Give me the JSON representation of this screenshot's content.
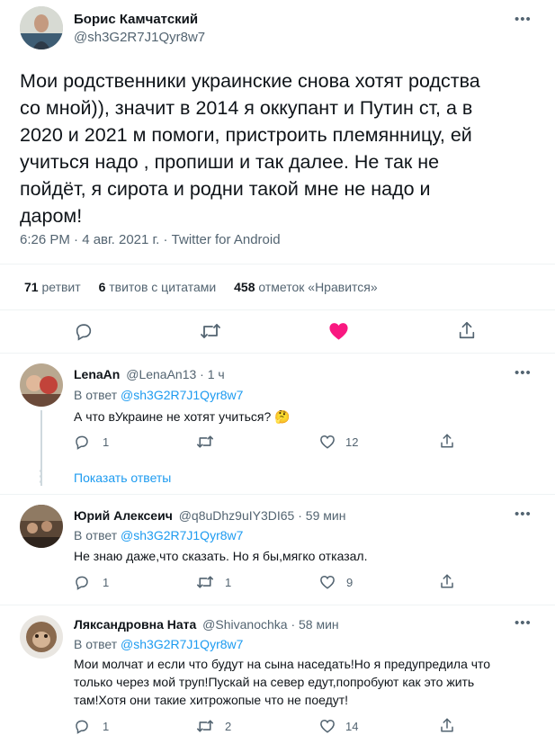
{
  "main_tweet": {
    "author_name": "Борис Камчатский",
    "author_handle": "@sh3G2R7J1Qyr8w7",
    "text_lines": [
      "Мои родственники украинские снова хотят родства",
      "со мной)), значит в 2014 я оккупант и Путин ст, а в",
      "2020 и 2021 м  помоги, пристроить племянницу, ей",
      "учиться надо , пропиши  и так далее.  Не  так не",
      "пойдёт, я сирота и родни такой мне не надо и",
      "даром!"
    ],
    "meta": "6:26 PM · 4 авг. 2021 г. · Twitter for Android",
    "stats": {
      "retweets_count": "71",
      "retweets_label": "ретвит",
      "quotes_count": "6",
      "quotes_label": "твитов с цитатами",
      "likes_count": "458",
      "likes_label": "отметок «Нравится»"
    },
    "like_color": "#f91880"
  },
  "replies": [
    {
      "name": "LenaAn",
      "handle_time": "@LenaAn13 · 1 ч",
      "reply_to_prefix": "В ответ",
      "reply_to_handle": "@sh3G2R7J1Qyr8w7",
      "text_lines": [
        "А что вУкраине не хотят учиться? 🤔"
      ],
      "comments": "1",
      "retweets": "",
      "likes": "12",
      "show_replies": "Показать ответы"
    },
    {
      "name": "Юрий Алексеич",
      "handle_time": "@q8uDhz9uIY3DI65 · 59 мин",
      "reply_to_prefix": "В ответ",
      "reply_to_handle": "@sh3G2R7J1Qyr8w7",
      "text_lines": [
        "Не знаю даже,что сказать. Но я бы,мягко отказал."
      ],
      "comments": "1",
      "retweets": "1",
      "likes": "9"
    },
    {
      "name": "Ляксандровна Ната",
      "handle_time": "@Shivanochka · 58 мин",
      "reply_to_prefix": "В ответ",
      "reply_to_handle": "@sh3G2R7J1Qyr8w7",
      "text_lines": [
        "Мои молчат и если что будут на сына наседать!Но я предупредила что",
        "только через мой труп!Пускай на север едут,попробуют как это жить",
        "там!Хотя они такие хитрожопые что не поедут!"
      ],
      "comments": "1",
      "retweets": "2",
      "likes": "14"
    }
  ],
  "colors": {
    "link": "#1d9bf0",
    "muted": "#536471",
    "divider": "#eff3f4"
  }
}
